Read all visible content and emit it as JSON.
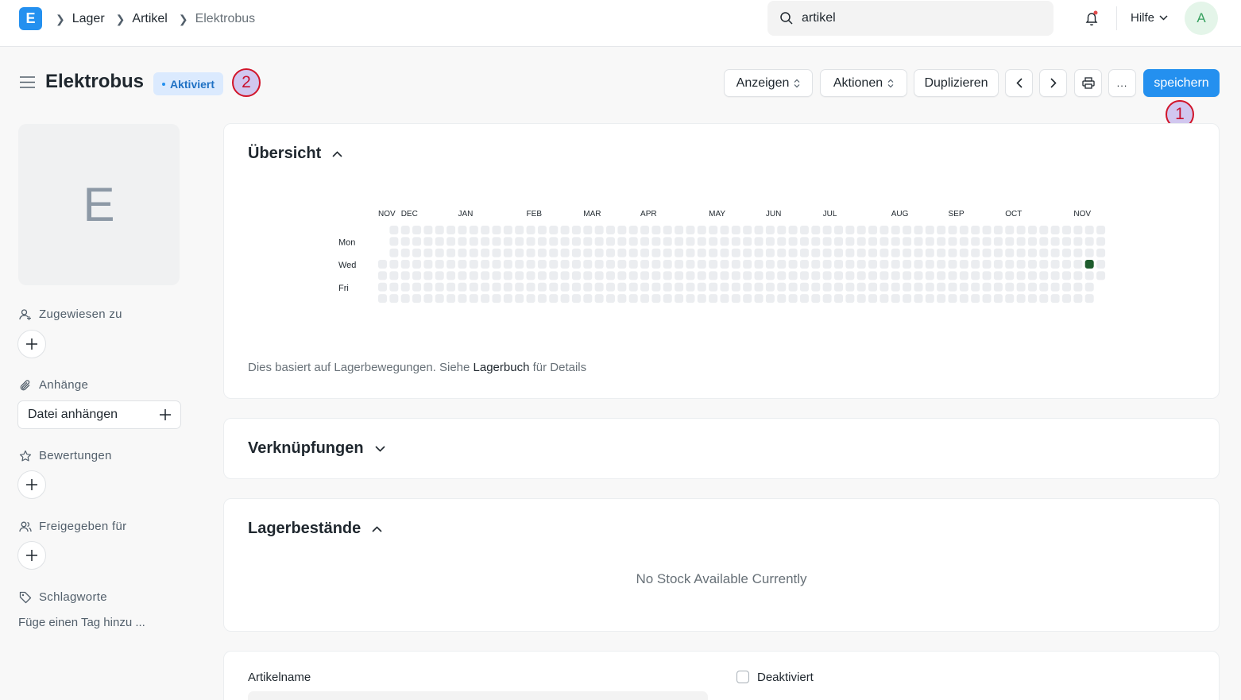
{
  "navbar": {
    "logo_letter": "E",
    "breadcrumbs": [
      "Lager",
      "Artikel",
      "Elektrobus"
    ],
    "search_value": "artikel",
    "help_label": "Hilfe",
    "avatar_letter": "A"
  },
  "header": {
    "title": "Elektrobus",
    "status": "Aktiviert",
    "buttons": {
      "view": "Anzeigen",
      "actions": "Aktionen",
      "duplicate": "Duplizieren",
      "more": "...",
      "save": "speichern"
    },
    "markers": [
      "1",
      "2"
    ]
  },
  "sidebar": {
    "image_letter": "E",
    "assigned_to": "Zugewiesen zu",
    "attachments": "Anhänge",
    "attach_file": "Datei anhängen",
    "ratings": "Bewertungen",
    "shared_with": "Freigegeben für",
    "tags": "Schlagworte",
    "add_tag_hint": "Füge einen Tag hinzu ..."
  },
  "overview": {
    "title": "Übersicht",
    "heatmap": {
      "months": [
        "NOV",
        "DEC",
        "JAN",
        "FEB",
        "MAR",
        "APR",
        "MAY",
        "JUN",
        "JUL",
        "AUG",
        "SEP",
        "OCT",
        "NOV"
      ],
      "weekday_labels": [
        "Mon",
        "Wed",
        "Fri"
      ],
      "empty_color": "#ebedf0",
      "active_color": "#1e5c2d"
    },
    "note_prefix": "Dies basiert auf Lagerbewegungen. Siehe ",
    "note_link": "Lagerbuch",
    "note_suffix": " für Details"
  },
  "connections": {
    "title": "Verknüpfungen"
  },
  "stock": {
    "title": "Lagerbestände",
    "empty": "No Stock Available Currently"
  },
  "details": {
    "item_name_label": "Artikelname",
    "disabled_label": "Deaktiviert"
  }
}
